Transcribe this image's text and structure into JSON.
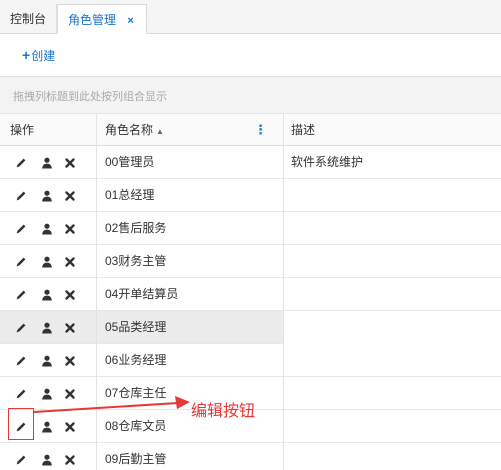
{
  "tabs": [
    {
      "label": "控制台"
    },
    {
      "label": "角色管理",
      "close": "×"
    }
  ],
  "toolbar": {
    "create_plus": "+",
    "create_label": "创建"
  },
  "group_hint": "拖拽列标题到此处按列组合显示",
  "columns": {
    "actions": "操作",
    "name": "角色名称",
    "name_sort": "▲",
    "menu": "⋮",
    "desc": "描述"
  },
  "rows": [
    {
      "name": "00管理员",
      "desc": "软件系统维护"
    },
    {
      "name": "01总经理",
      "desc": ""
    },
    {
      "name": "02售后服务",
      "desc": ""
    },
    {
      "name": "03财务主管",
      "desc": ""
    },
    {
      "name": "04开单结算员",
      "desc": ""
    },
    {
      "name": "05品类经理",
      "desc": ""
    },
    {
      "name": "06业务经理",
      "desc": ""
    },
    {
      "name": "07仓库主任",
      "desc": ""
    },
    {
      "name": "08仓库文员",
      "desc": ""
    },
    {
      "name": "09后勤主管",
      "desc": ""
    }
  ],
  "highlighted_row": 5,
  "annotation": {
    "text": "编辑按钮",
    "color": "#e53935"
  },
  "colors": {
    "accent": "#1a73c8",
    "annotation": "#e53935",
    "highlight_row": "#ececec"
  },
  "icons": {
    "edit": "pencil-icon",
    "user": "user-icon",
    "delete": "close-icon"
  }
}
